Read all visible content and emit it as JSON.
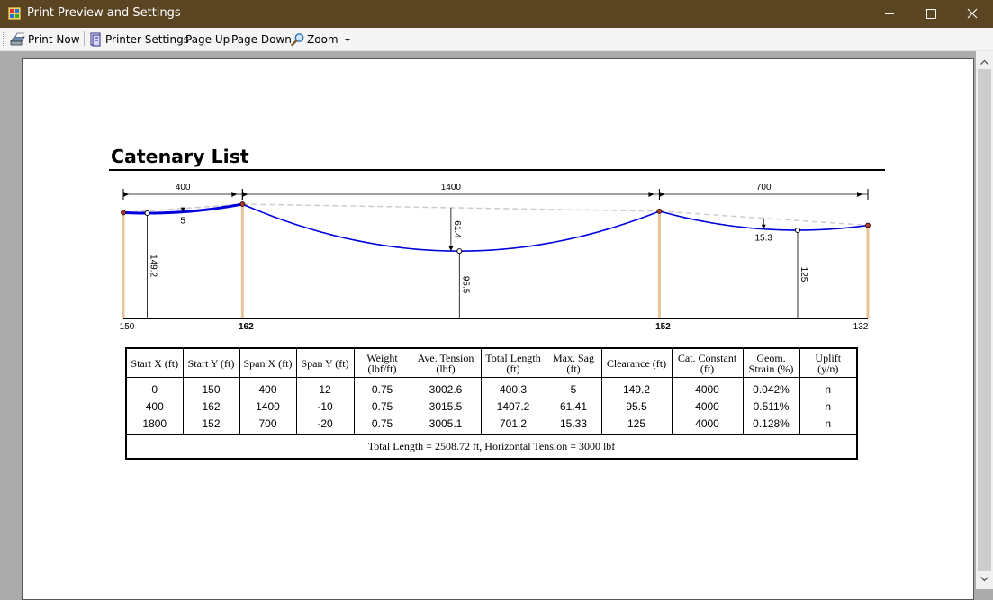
{
  "window": {
    "title": "Print Preview and Settings"
  },
  "toolbar": {
    "print_now": "Print Now",
    "printer_settings": "Printer Settings",
    "page_up": "Page Up",
    "page_down": "Page Down",
    "zoom": "Zoom"
  },
  "report": {
    "heading": "Catenary List"
  },
  "diagram": {
    "span_widths": [
      "400",
      "1400",
      "700"
    ],
    "pole_heights": [
      "150",
      "162",
      "152",
      "132"
    ],
    "sag_labels": [
      "5",
      "61.4",
      "15.3"
    ],
    "clearance_labels": [
      "149.2",
      "95.5",
      "125"
    ],
    "colors": {
      "cable": "#0000dd",
      "pole": "#e7c596",
      "chord": "#cccccc"
    }
  },
  "table": {
    "headers": [
      [
        "Start X (ft)"
      ],
      [
        "Start Y (ft)"
      ],
      [
        "Span X (ft)"
      ],
      [
        "Span Y (ft)"
      ],
      [
        "Weight",
        "(lbf/ft)"
      ],
      [
        "Ave. Tension",
        "(lbf)"
      ],
      [
        "Total Length",
        "(ft)"
      ],
      [
        "Max. Sag",
        "(ft)"
      ],
      [
        "Clearance (ft)"
      ],
      [
        "Cat. Constant",
        "(ft)"
      ],
      [
        "Geom.",
        "Strain (%)"
      ],
      [
        "Uplift",
        "(y/n)"
      ]
    ],
    "rows": [
      [
        "0",
        "150",
        "400",
        "12",
        "0.75",
        "3002.6",
        "400.3",
        "5",
        "149.2",
        "4000",
        "0.042%",
        "n"
      ],
      [
        "400",
        "162",
        "1400",
        "-10",
        "0.75",
        "3015.5",
        "1407.2",
        "61.41",
        "95.5",
        "4000",
        "0.511%",
        "n"
      ],
      [
        "1800",
        "152",
        "700",
        "-20",
        "0.75",
        "3005.1",
        "701.2",
        "15.33",
        "125",
        "4000",
        "0.128%",
        "n"
      ]
    ],
    "summary": "Total Length = 2508.72 ft, Horizontal Tension = 3000 lbf"
  }
}
